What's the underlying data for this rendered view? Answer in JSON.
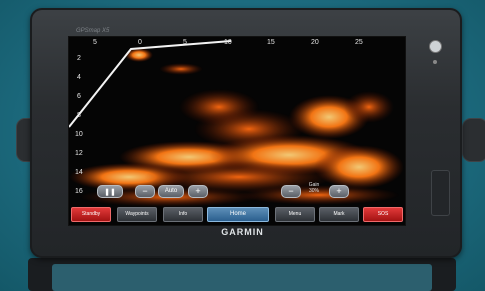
{
  "device": {
    "model": "GPSmap X5",
    "brand": "GARMIN"
  },
  "sonar": {
    "range_ticks": [
      "5",
      "0",
      "5",
      "10",
      "15",
      "20",
      "25"
    ],
    "depth_ticks": [
      "2",
      "4",
      "6",
      "8",
      "10",
      "12",
      "14",
      "16"
    ]
  },
  "controls": {
    "pause_icon": "pause-icon",
    "zoom_minus": "−",
    "zoom_label": "Auto",
    "zoom_plus": "+",
    "gain_minus": "−",
    "gain_label": "Gain",
    "gain_value": "30%",
    "gain_plus": "+"
  },
  "softkeys": [
    {
      "label": "Standby"
    },
    {
      "label": "Waypoints"
    },
    {
      "label": "Info"
    },
    {
      "label": "Home"
    },
    {
      "label": "Menu"
    },
    {
      "label": "Mark"
    },
    {
      "label": "SOS"
    }
  ],
  "colors": {
    "accent_red": "#d42424",
    "home_blue": "#3d72a3",
    "sonar_hot": "#ff8a1a"
  }
}
